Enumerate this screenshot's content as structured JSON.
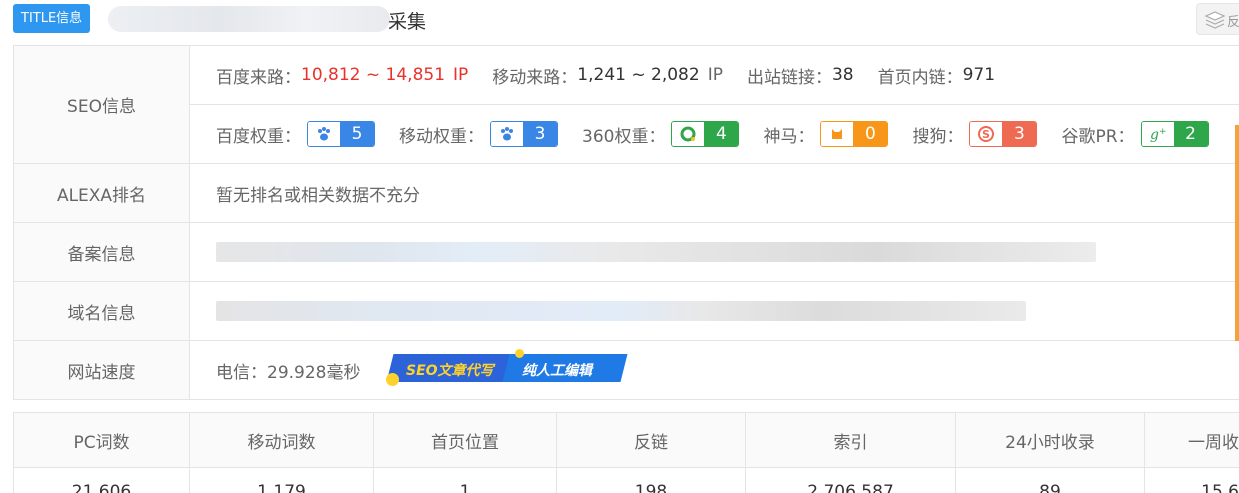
{
  "header": {
    "badge": "TITLE信息",
    "title_visible": "采集",
    "tool_label": "反"
  },
  "seo": {
    "label": "SEO信息",
    "baidu_traffic_label": "百度来路：",
    "baidu_traffic_value": "10,812 ~ 14,851",
    "baidu_traffic_unit": "IP",
    "mobile_traffic_label": "移动来路：",
    "mobile_traffic_value": "1,241 ~ 2,082",
    "mobile_traffic_unit": "IP",
    "outbound_label": "出站链接：",
    "outbound_value": "38",
    "inbound_label": "首页内链：",
    "inbound_value": "971",
    "weights": [
      {
        "label": "百度权重：",
        "value": "5",
        "icon": "baidu-paw-icon",
        "color": "#3a86e6"
      },
      {
        "label": "移动权重：",
        "value": "3",
        "icon": "mobile-paw-icon",
        "color": "#3a86e6"
      },
      {
        "label": "360权重：",
        "value": "4",
        "icon": "360-icon",
        "color": "#2ea64a"
      },
      {
        "label": "神马：",
        "value": "0",
        "icon": "shenma-icon",
        "color": "#f79618"
      },
      {
        "label": "搜狗：",
        "value": "3",
        "icon": "sogou-icon",
        "color": "#ef6a53"
      },
      {
        "label": "谷歌PR：",
        "value": "2",
        "icon": "google-plus-icon",
        "color": "#2ea64a"
      }
    ]
  },
  "alexa": {
    "label": "ALEXA排名",
    "value": "暂无排名或相关数据不充分"
  },
  "icp": {
    "label": "备案信息"
  },
  "domain": {
    "label": "域名信息"
  },
  "speed": {
    "label": "网站速度",
    "value": "电信：29.928毫秒",
    "ad_left": "SEO文章代写",
    "ad_right": "纯人工编辑"
  },
  "stats": {
    "headers": [
      "PC词数",
      "移动词数",
      "首页位置",
      "反链",
      "索引",
      "24小时收录",
      "一周收"
    ],
    "values": [
      "21,606",
      "1,179",
      "1",
      "198",
      "2,706,587",
      "89",
      "15,6"
    ]
  },
  "colors": {
    "accent": "#2e97f0",
    "red": "#e8322b",
    "orange": "#f5a13c"
  }
}
